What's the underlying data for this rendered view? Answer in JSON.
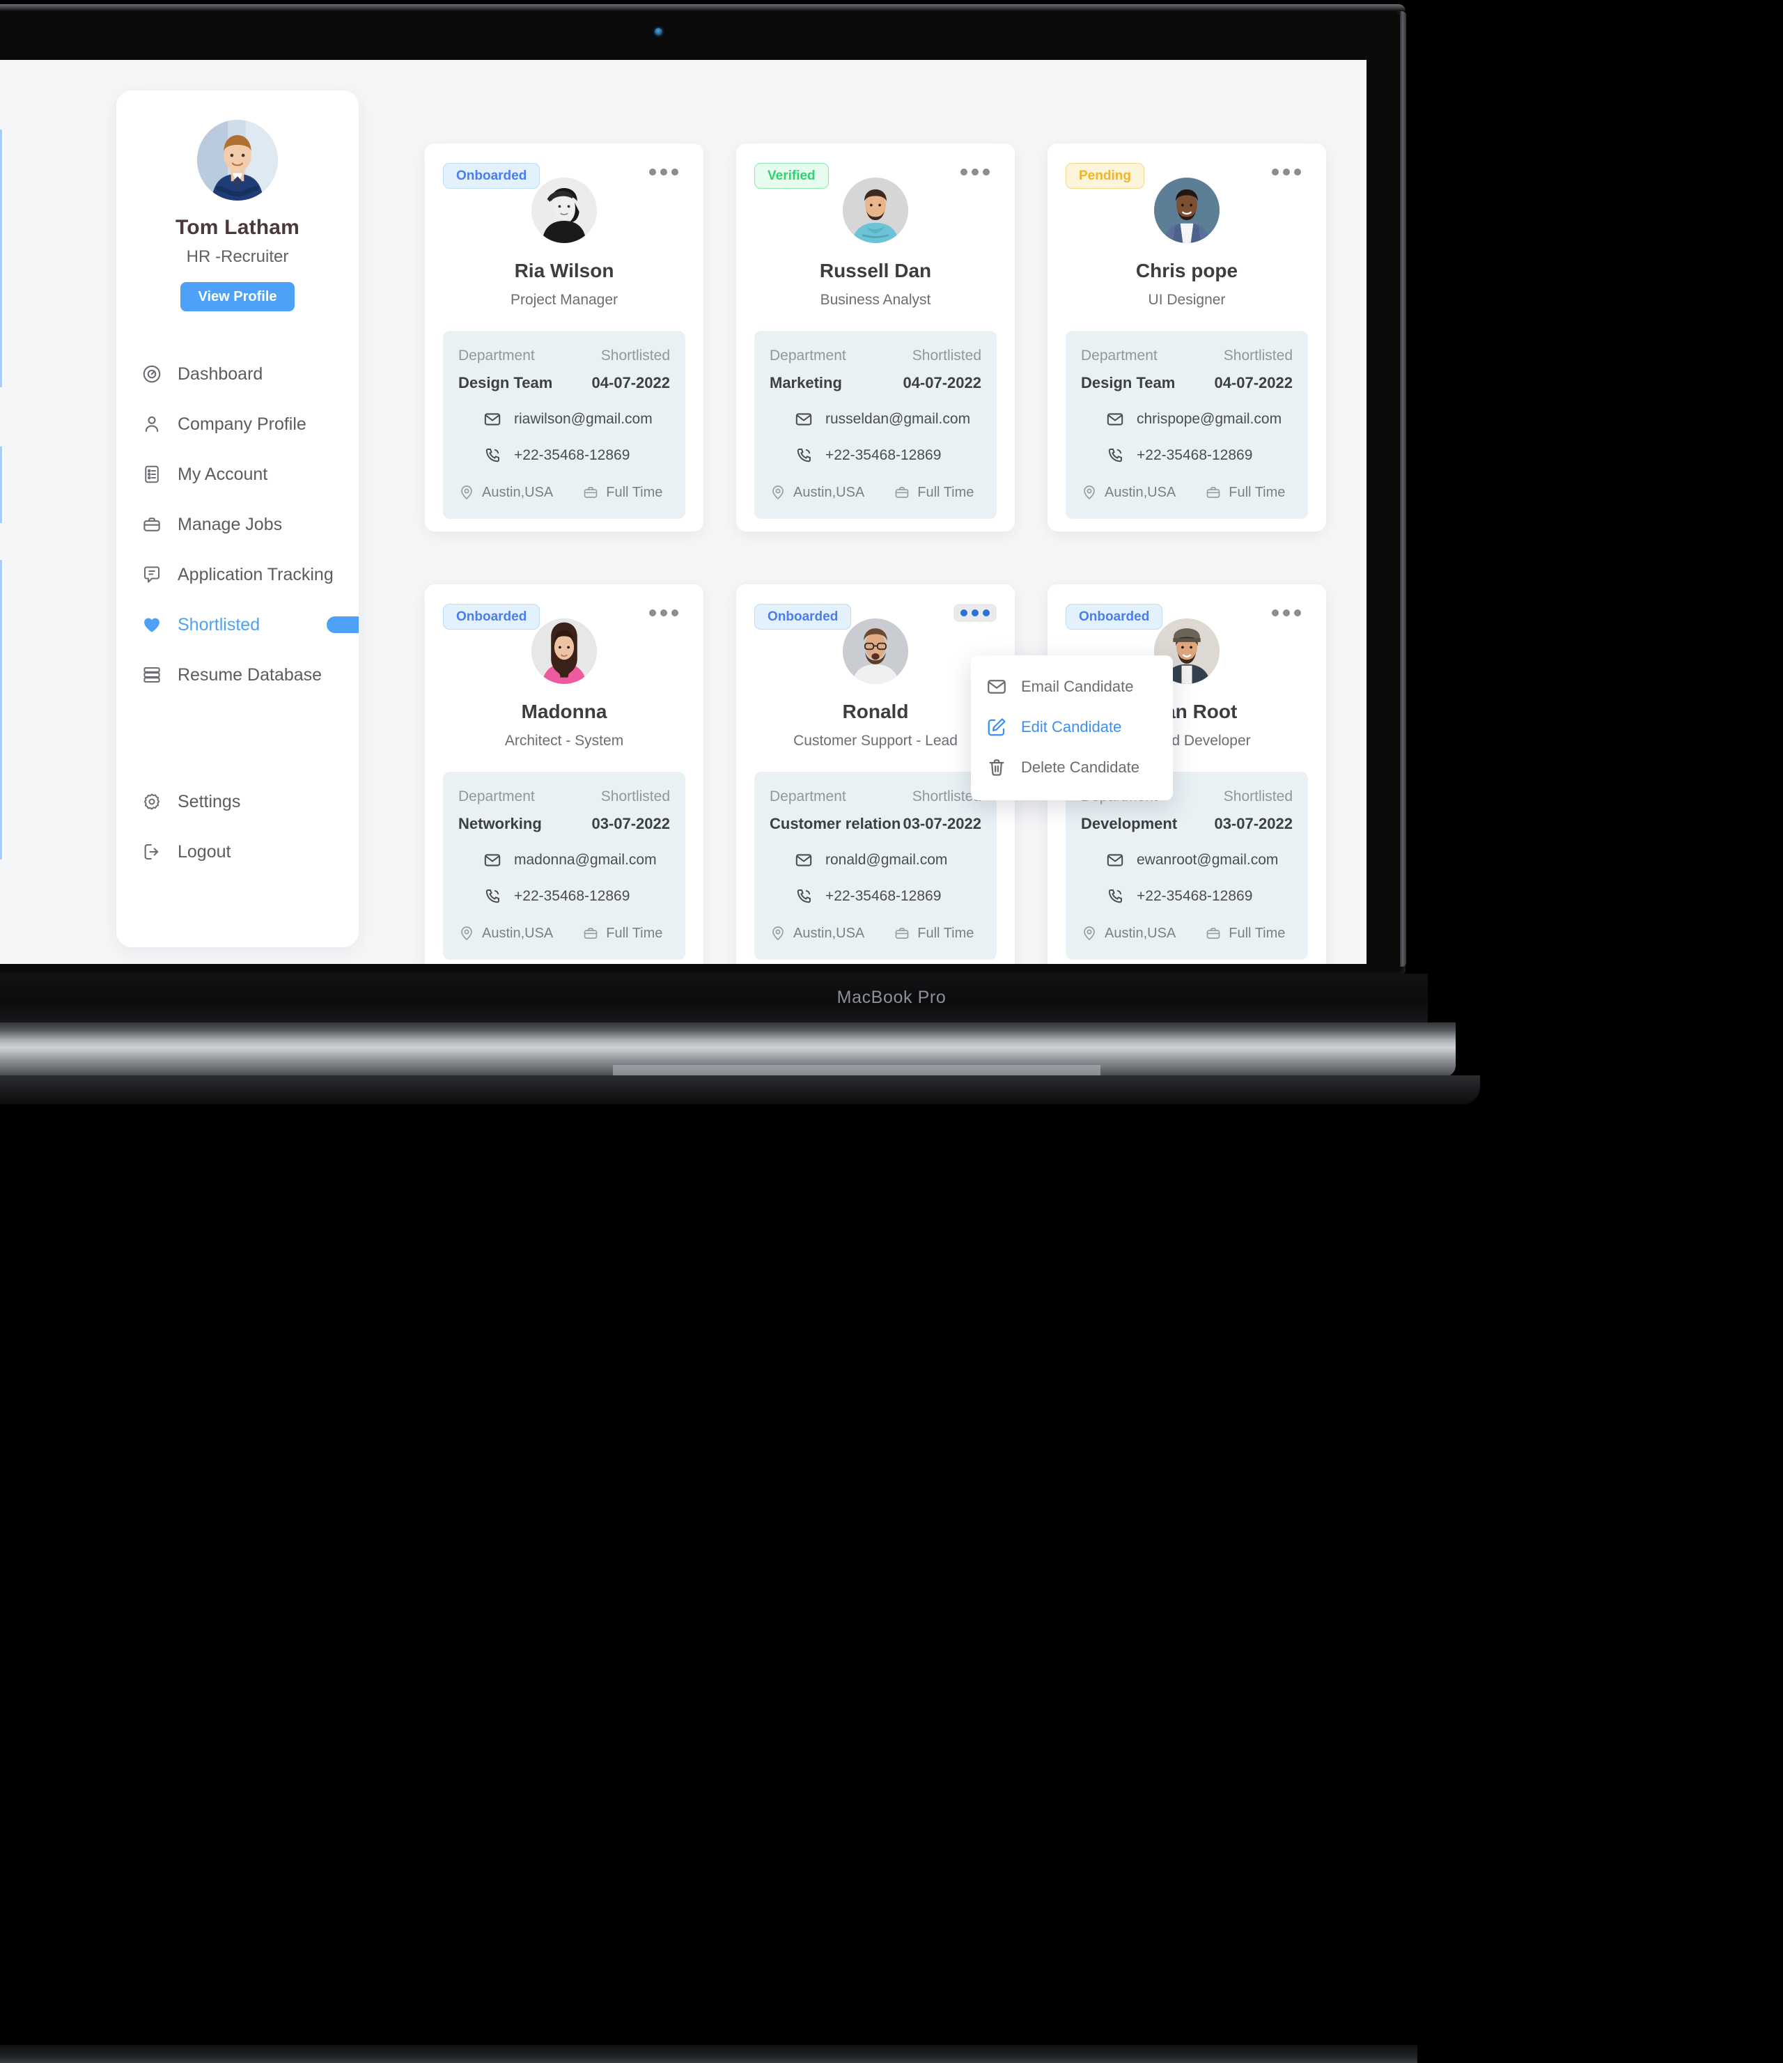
{
  "device": {
    "label": "MacBook Pro",
    "webcam_icon": "webcam-dot"
  },
  "sidebar": {
    "profile": {
      "name": "Tom Latham",
      "role": "HR -Recruiter",
      "avatar_icon": "user-avatar-photo",
      "view_profile_label": "View Profile"
    },
    "items": [
      {
        "label": "Dashboard",
        "icon": "speedometer-icon",
        "active": false
      },
      {
        "label": "Company Profile",
        "icon": "person-icon",
        "active": false
      },
      {
        "label": "My Account",
        "icon": "account-list-icon",
        "active": false
      },
      {
        "label": "Manage Jobs",
        "icon": "briefcase-icon",
        "active": false
      },
      {
        "label": "Application Tracking",
        "icon": "chat-doc-icon",
        "active": false
      },
      {
        "label": "Shortlisted",
        "icon": "heart-icon",
        "active": true
      },
      {
        "label": "Resume Database",
        "icon": "database-icon",
        "active": false
      }
    ],
    "footer_items": [
      {
        "label": "Settings",
        "icon": "gear-icon"
      },
      {
        "label": "Logout",
        "icon": "logout-icon"
      }
    ]
  },
  "card_labels": {
    "department": "Department",
    "shortlisted": "Shortlisted"
  },
  "menu": {
    "items": [
      {
        "label": "Email Candidate",
        "icon": "envelope-icon",
        "highlight": false
      },
      {
        "label": "Edit Candidate",
        "icon": "edit-pen-icon",
        "highlight": true
      },
      {
        "label": "Delete Candidate",
        "icon": "trash-icon",
        "highlight": false
      }
    ]
  },
  "colors": {
    "accent": "#4da2f7",
    "badge_onboarded": "#4a7ef0",
    "badge_verified": "#2fd36d",
    "badge_pending": "#f0b429",
    "info_panel": "#e9f1f4",
    "page_bg": "#f5f6f7"
  },
  "candidates": [
    {
      "badge": "Onboarded",
      "badge_type": "onboarded",
      "name": "Ria Wilson",
      "role": "Project Manager",
      "department": "Design Team",
      "shortlisted": "04-07-2022",
      "email": "riawilson@gmail.com",
      "phone": "+22-35468-12869",
      "location": "Austin,USA",
      "job_type": "Full Time",
      "avatar_icon": "candidate-photo-bw-woman",
      "menu_open": false
    },
    {
      "badge": "Verified",
      "badge_type": "verified",
      "name": "Russell Dan",
      "role": "Business Analyst",
      "department": "Marketing",
      "shortlisted": "04-07-2022",
      "email": "russeldan@gmail.com",
      "phone": "+22-35468-12869",
      "location": "Austin,USA",
      "job_type": "Full Time",
      "avatar_icon": "candidate-photo-man-teal",
      "menu_open": false
    },
    {
      "badge": "Pending",
      "badge_type": "pending",
      "name": "Chris pope",
      "role": "UI Designer",
      "department": "Design Team",
      "shortlisted": "04-07-2022",
      "email": "chrispope@gmail.com",
      "phone": "+22-35468-12869",
      "location": "Austin,USA",
      "job_type": "Full Time",
      "avatar_icon": "candidate-photo-man-blue",
      "menu_open": false
    },
    {
      "badge": "Onboarded",
      "badge_type": "onboarded",
      "name": "Madonna",
      "role": "Architect - System",
      "department": "Networking",
      "shortlisted": "03-07-2022",
      "email": "madonna@gmail.com",
      "phone": "+22-35468-12869",
      "location": "Austin,USA",
      "job_type": "Full Time",
      "avatar_icon": "candidate-photo-woman-pink",
      "menu_open": false
    },
    {
      "badge": "Onboarded",
      "badge_type": "onboarded",
      "name": "Ronald",
      "role": "Customer Support - Lead",
      "department": "Customer relation",
      "shortlisted": "03-07-2022",
      "email": "ronald@gmail.com",
      "phone": "+22-35468-12869",
      "location": "Austin,USA",
      "job_type": "Full Time",
      "avatar_icon": "candidate-photo-man-glasses",
      "menu_open": true
    },
    {
      "badge": "Onboarded",
      "badge_type": "onboarded",
      "name": "Ewan Root",
      "role": "Backend Developer",
      "department": "Development",
      "shortlisted": "03-07-2022",
      "email": "ewanroot@gmail.com",
      "phone": "+22-35468-12869",
      "location": "Austin,USA",
      "job_type": "Full Time",
      "avatar_icon": "candidate-photo-man-beanie",
      "menu_open": false
    }
  ]
}
